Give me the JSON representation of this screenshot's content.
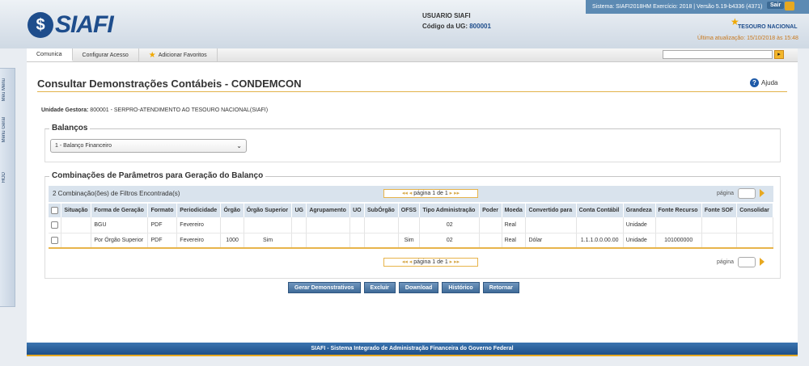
{
  "header": {
    "logo_text": "SIAFI",
    "user_label": "USUARIO SIAFI",
    "ug_label": "Código da UG: ",
    "ug_code": "800001",
    "system_info": "Sistema: SIAFI2018HM Exercício: 2018 | Versão 5.19-b4336 (4371)",
    "sair_label": "Sair",
    "tesouro_label": "TESOURO NACIONAL",
    "last_update": "Última atualização: 15/10/2018 às 15:48"
  },
  "nav": {
    "tabs": [
      {
        "label": "Comunica"
      },
      {
        "label": "Configurar Acesso"
      },
      {
        "label": "Adicionar Favoritos"
      }
    ],
    "search_placeholder": ""
  },
  "sidebar": {
    "items": [
      "Meu Menu",
      "Menu Geral",
      "HOD"
    ]
  },
  "page": {
    "title": "Consultar Demonstrações Contábeis - CONDEMCON",
    "help_label": "Ajuda",
    "unidade_label": "Unidade Gestora:",
    "unidade_value": " 800001 - SERPRO-ATENDIMENTO AO TESOURO NACIONAL(SIAFI)",
    "balancos_legend": "Balanços",
    "balanco_selected": "1 - Balanço Financeiro",
    "combinacoes_legend": "Combinações de Parâmetros para Geração do Balanço",
    "count_text": "2 Combinação(ões) de Filtros Encontrada(s)",
    "pager_text": "página 1 de 1",
    "pagina_label": "página"
  },
  "table": {
    "headers": [
      "",
      "Situação",
      "Forma de Geração",
      "Formato",
      "Periodicidade",
      "Órgão",
      "Órgão Superior",
      "UG",
      "Agrupamento",
      "UO",
      "SubÓrgão",
      "OFSS",
      "Tipo Administração",
      "Poder",
      "Moeda",
      "Convertido para",
      "Conta Contábil",
      "Grandeza",
      "Fonte Recurso",
      "Fonte SOF",
      "Consolidar"
    ],
    "rows": [
      [
        "",
        "",
        "BGU",
        "PDF",
        "Fevereiro",
        "",
        "",
        "",
        "",
        "",
        "",
        "",
        "02",
        "",
        "Real",
        "",
        "",
        "Unidade",
        "",
        "",
        ""
      ],
      [
        "",
        "",
        "Por Órgão Superior",
        "PDF",
        "Fevereiro",
        "1000",
        "Sim",
        "",
        "",
        "",
        "",
        "Sim",
        "02",
        "",
        "Real",
        "Dólar",
        "1.1.1.0.0.00.00",
        "Unidade",
        "101000000",
        "",
        ""
      ]
    ]
  },
  "buttons": {
    "gerar": "Gerar Demonstrativos",
    "excluir": "Excluir",
    "download": "Download",
    "historico": "Histórico",
    "retornar": "Retornar"
  },
  "footer": {
    "text": "SIAFI - Sistema Integrado de Administração Financeira do Governo Federal"
  },
  "colors": {
    "brand": "#1e4d8c",
    "accent": "#e7a820"
  }
}
